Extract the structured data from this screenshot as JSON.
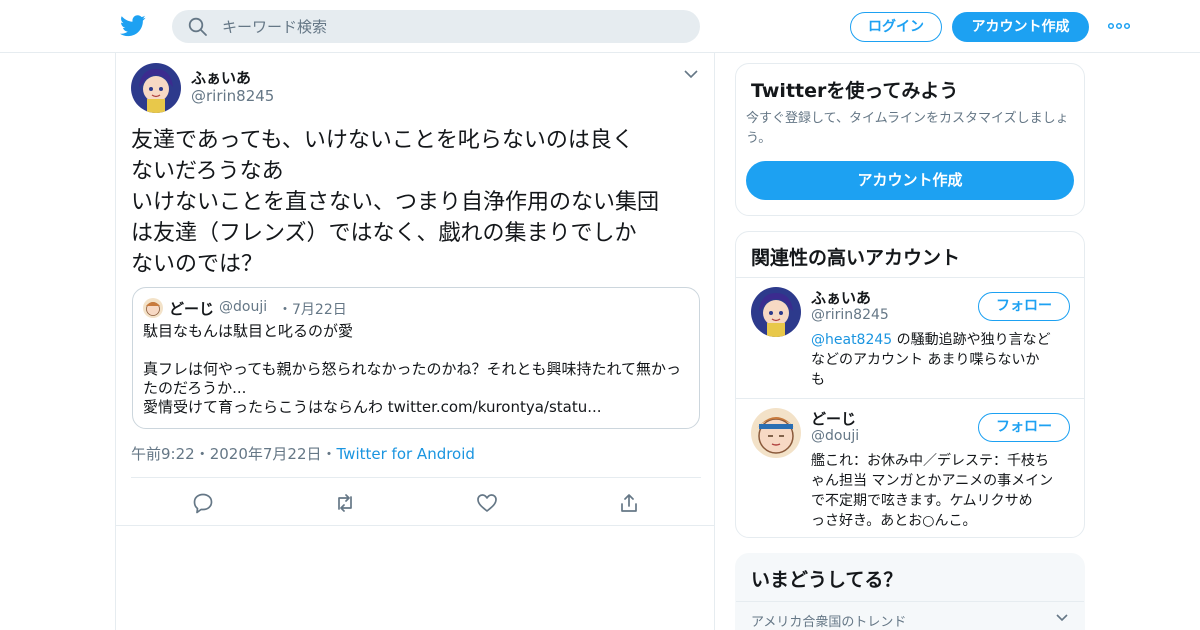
{
  "brand": {
    "accent": "#1da1f2",
    "link": "#1b95e0",
    "muted": "#657786"
  },
  "header": {
    "search_placeholder": "キーワード検索",
    "login_label": "ログイン",
    "signup_label": "アカウント作成"
  },
  "tweet": {
    "name": "ふぁいあ",
    "handle": "@ririn8245",
    "text": "友達であっても、いけないことを叱らないのは良く\nないだろうなあ\nいけないことを直さない、つまり自浄作用のない集団\nは友達（フレンズ）ではなく、戯れの集まりでしか\nないのでは？",
    "quote": {
      "name": "どーじ",
      "handle": "@douji",
      "date": "・7月22日",
      "text": "駄目なもんは駄目と叱るのが愛\n\n真フレは何やっても親から怒られなかったのかね？それとも興味持たれて無かっ\nたのだろうか...\n愛情受けて育ったらこうはならんわ twitter.com/kurontya/statu..."
    },
    "time": "午前9:22",
    "date": "・2020年7月22日・",
    "source": "Twitter for Android"
  },
  "sidebar": {
    "signup_card": {
      "title": "Twitterを使ってみよう",
      "description": "今すぐ登録して、タイムラインをカスタマイズしましょう。",
      "button_label": "アカウント作成"
    },
    "related": {
      "title": "関連性の高いアカウント",
      "follow_label": "フォロー",
      "accounts": [
        {
          "name": "ふぁいあ",
          "handle": "@ririn8245",
          "bio_mention": "@heat8245",
          "bio": " の騒動追跡や独り言など\nなどのアカウント あまり喋らないか\nも"
        },
        {
          "name": "どーじ",
          "handle": "@douji",
          "bio_mention": "",
          "bio": "艦これ：お休み中／デレステ：千枝ち\nゃん担当 マンガとかアニメの事メイン\nで不定期で呟きます。ケムリクサめ\nっさ好き。あとお○んこ。"
        }
      ]
    },
    "trends": {
      "title": "いまどうしてる？",
      "subtitle": "アメリカ合衆国のトレンド"
    }
  }
}
